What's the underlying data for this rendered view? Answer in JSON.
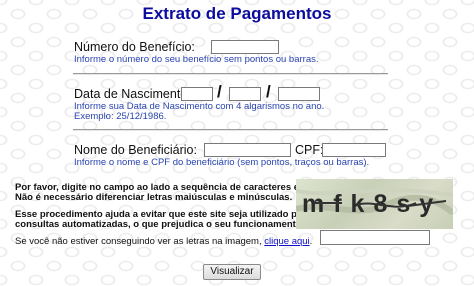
{
  "page_title": "Extrato de Pagamentos",
  "beneficio": {
    "label": "Número do Benefício:",
    "hint": "Informe o número do seu benefício sem pontos ou barras."
  },
  "nascimento": {
    "label": "Data de Nascimento:",
    "separator": "/",
    "hint_line1": "Informe sua Data de Nascimento com 4 algarismos no ano.",
    "hint_line2": "Exemplo: 25/12/1986."
  },
  "beneficiario": {
    "label": "Nome do Beneficiário:",
    "cpf_label": "CPF:",
    "hint": "Informe o nome e CPF do beneficiário (sem pontos, traços ou barras)."
  },
  "captcha": {
    "instruction_line1": "Por favor, digite no campo ao lado a sequência de caracteres exibida.",
    "instruction_line2": "Não é necessário diferenciar letras maiúsculas e minúsculas.",
    "purpose_line1": "Esse procedimento ajuda a evitar que este site seja utilizado por",
    "purpose_line2": "consultas automatizadas, o que prejudica o seu funcionamento.",
    "fallback_text": "Se você não estiver conseguindo ver as letras na imagem,",
    "fallback_link": "clique aqui",
    "fallback_end": ".",
    "image_text": "mfk8sy"
  },
  "submit_label": "Visualizar"
}
